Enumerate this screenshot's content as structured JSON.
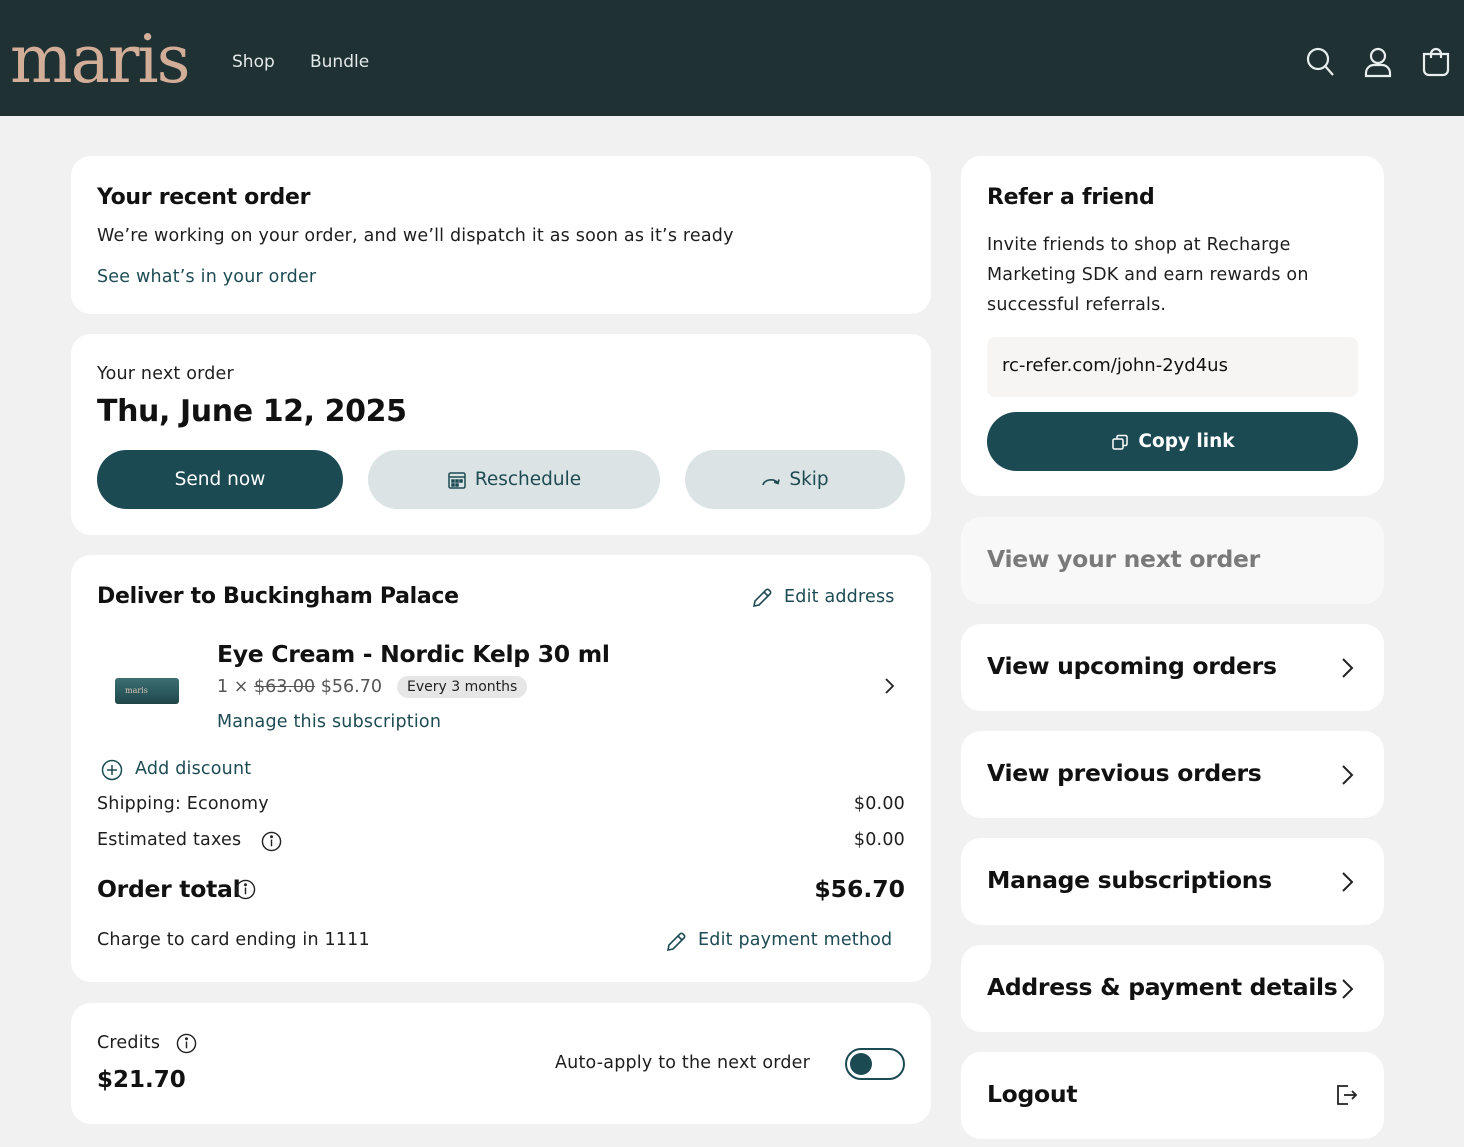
{
  "header": {
    "logo": "maris",
    "nav": [
      "Shop",
      "Bundle"
    ],
    "icons": [
      "search-icon",
      "account-icon",
      "cart-icon"
    ]
  },
  "recent_order": {
    "title": "Your recent order",
    "message": "We’re working on your order, and we’ll dispatch it as soon as it’s ready",
    "link": "See what’s in your order"
  },
  "next_order": {
    "label": "Your next order",
    "date": "Thu, June 12, 2025",
    "send_now": "Send now",
    "reschedule": "Reschedule",
    "skip": "Skip"
  },
  "delivery": {
    "title": "Deliver to Buckingham Palace",
    "edit_address": "Edit address",
    "product": {
      "name": "Eye Cream - Nordic Kelp 30 ml",
      "thumb_text": "maris",
      "qty": "1 ×",
      "original_price": "$63.00",
      "price": "$56.70",
      "frequency": "Every 3 months",
      "manage": "Manage this subscription"
    },
    "add_discount": "Add discount",
    "shipping_label": "Shipping: Economy",
    "shipping_value": "$0.00",
    "taxes_label": "Estimated taxes",
    "taxes_value": "$0.00",
    "total_label": "Order total",
    "total_value": "$56.70",
    "card_text": "Charge to card ending in 1111",
    "edit_payment": "Edit payment method"
  },
  "credits": {
    "label": "Credits",
    "value": "$21.70",
    "auto_apply": "Auto-apply to the next order",
    "auto_apply_on": false
  },
  "refer": {
    "title": "Refer a friend",
    "line1": "Invite friends to shop at Recharge",
    "line2": "Marketing SDK and earn rewards on",
    "line3": "successful referrals.",
    "url": "rc-refer.com/john-2yd4us",
    "copy": "Copy link"
  },
  "side_nav": {
    "next_order": "View your next order",
    "upcoming": "View upcoming orders",
    "previous": "View previous orders",
    "subscriptions": "Manage subscriptions",
    "address_payment": "Address & payment details",
    "logout": "Logout"
  }
}
